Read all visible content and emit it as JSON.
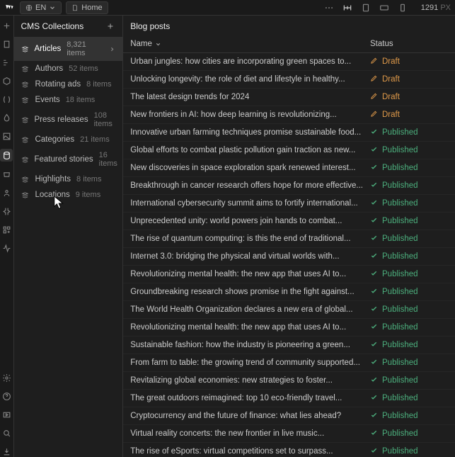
{
  "topbar": {
    "lang": "EN",
    "page": "Home",
    "viewport_value": "1291",
    "viewport_unit": "PX"
  },
  "collections": {
    "title": "CMS Collections",
    "items": [
      {
        "name": "Articles",
        "count": "8,321 items",
        "active": true
      },
      {
        "name": "Authors",
        "count": "52 items"
      },
      {
        "name": "Rotating ads",
        "count": "8 items"
      },
      {
        "name": "Events",
        "count": "18 items"
      },
      {
        "name": "Press releases",
        "count": "108 items"
      },
      {
        "name": "Categories",
        "count": "21 items"
      },
      {
        "name": "Featured stories",
        "count": "16 items"
      },
      {
        "name": "Highlights",
        "count": "8 items"
      },
      {
        "name": "Locations",
        "count": "9 items"
      }
    ]
  },
  "content": {
    "title": "Blog posts",
    "cols": {
      "name": "Name",
      "status": "Status"
    },
    "status_labels": {
      "draft": "Draft",
      "published": "Published"
    },
    "rows": [
      {
        "name": "Urban jungles: how cities are incorporating green spaces to...",
        "status": "draft"
      },
      {
        "name": "Unlocking longevity: the role of diet and lifestyle in healthy...",
        "status": "draft"
      },
      {
        "name": "The latest design trends for 2024",
        "status": "draft"
      },
      {
        "name": "New frontiers in AI: how deep learning is revolutionizing...",
        "status": "draft"
      },
      {
        "name": "Innovative urban farming techniques promise sustainable food...",
        "status": "published"
      },
      {
        "name": "Global efforts to combat plastic pollution gain traction as new...",
        "status": "published"
      },
      {
        "name": "New discoveries in space exploration spark renewed interest...",
        "status": "published"
      },
      {
        "name": "Breakthrough in cancer research offers hope for more effective...",
        "status": "published"
      },
      {
        "name": "International cybersecurity summit aims to fortify international...",
        "status": "published"
      },
      {
        "name": "Unprecedented unity: world powers join hands to combat...",
        "status": "published"
      },
      {
        "name": "The rise of quantum computing: is this the end of traditional...",
        "status": "published"
      },
      {
        "name": "Internet 3.0: bridging the physical and virtual worlds with...",
        "status": "published"
      },
      {
        "name": "Revolutionizing mental health: the new app that uses AI to...",
        "status": "published"
      },
      {
        "name": "Groundbreaking research shows promise in the fight against...",
        "status": "published"
      },
      {
        "name": "The World Health Organization declares a new era of global...",
        "status": "published"
      },
      {
        "name": "Revolutionizing mental health: the new app that uses AI to...",
        "status": "published"
      },
      {
        "name": "Sustainable fashion: how the industry is pioneering a green...",
        "status": "published"
      },
      {
        "name": "From farm to table: the growing trend of community supported...",
        "status": "published"
      },
      {
        "name": "Revitalizing global economies: new strategies to foster...",
        "status": "published"
      },
      {
        "name": "The great outdoors reimagined: top 10 eco-friendly travel...",
        "status": "published"
      },
      {
        "name": "Cryptocurrency and the future of finance: what lies ahead?",
        "status": "published"
      },
      {
        "name": "Virtual reality concerts: the new frontier in live music...",
        "status": "published"
      },
      {
        "name": "The rise of eSports: virtual competitions set to surpass...",
        "status": "published"
      }
    ]
  }
}
